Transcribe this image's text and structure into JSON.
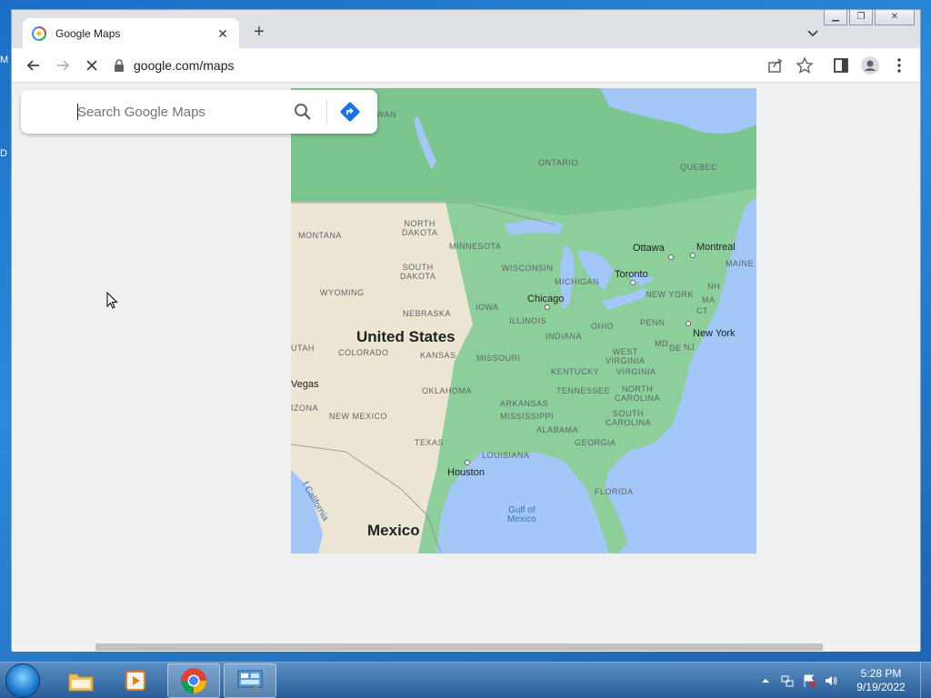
{
  "desktop": {
    "edge_fragments": [
      "M",
      "D"
    ]
  },
  "browser": {
    "tab": {
      "title": "Google Maps"
    },
    "url": "google.com/maps"
  },
  "maps": {
    "search": {
      "placeholder": "Search Google Maps"
    },
    "labels": {
      "wan": "WAN",
      "ontario": "ONTARIO",
      "quebec": "QUEBEC",
      "north_dakota": "NORTH\nDAKOTA",
      "montana": "MONTANA",
      "minnesota": "MINNESOTA",
      "wisconsin": "WISCONSIN",
      "michigan": "MICHIGAN",
      "south_dakota": "SOUTH\nDAKOTA",
      "wyoming": "WYOMING",
      "iowa": "IOWA",
      "nebraska": "NEBRASKA",
      "illinois": "ILLINOIS",
      "ohio": "OHIO",
      "penn": "PENN",
      "new_york_state": "NEW YORK",
      "maine": "MAINE",
      "nh": "NH",
      "ma": "MA",
      "ct": "CT",
      "nj": "NJ",
      "md": "MD",
      "de": "DE",
      "utah": "UTAH",
      "colorado": "COLORADO",
      "kansas": "KANSAS",
      "missouri": "MISSOURI",
      "indiana": "INDIANA",
      "west_virginia": "WEST\nVIRGINIA",
      "virginia": "VIRGINIA",
      "kentucky": "KENTUCKY",
      "oklahoma": "OKLAHOMA",
      "tennessee": "TENNESSEE",
      "north_carolina": "NORTH\nCAROLINA",
      "arkansas": "ARKANSAS",
      "mississippi": "MISSISSIPPI",
      "south_carolina": "SOUTH\nCAROLINA",
      "alabama": "ALABAMA",
      "georgia": "GEORGIA",
      "arizona": "IZONA",
      "new_mexico": "NEW MEXICO",
      "texas": "TEXAS",
      "louisiana": "LOUISIANA",
      "florida": "FLORIDA",
      "united_states": "United States",
      "mexico": "Mexico",
      "vegas": "Vegas",
      "ottawa": "Ottawa",
      "montreal": "Montreal",
      "toronto": "Toronto",
      "chicago": "Chicago",
      "new_york": "New York",
      "houston": "Houston",
      "gulf_of_mexico": "Gulf of\nMexico",
      "gulf_of_california": "f California"
    }
  },
  "taskbar": {
    "clock": {
      "time": "5:28 PM",
      "date": "9/19/2022"
    }
  }
}
